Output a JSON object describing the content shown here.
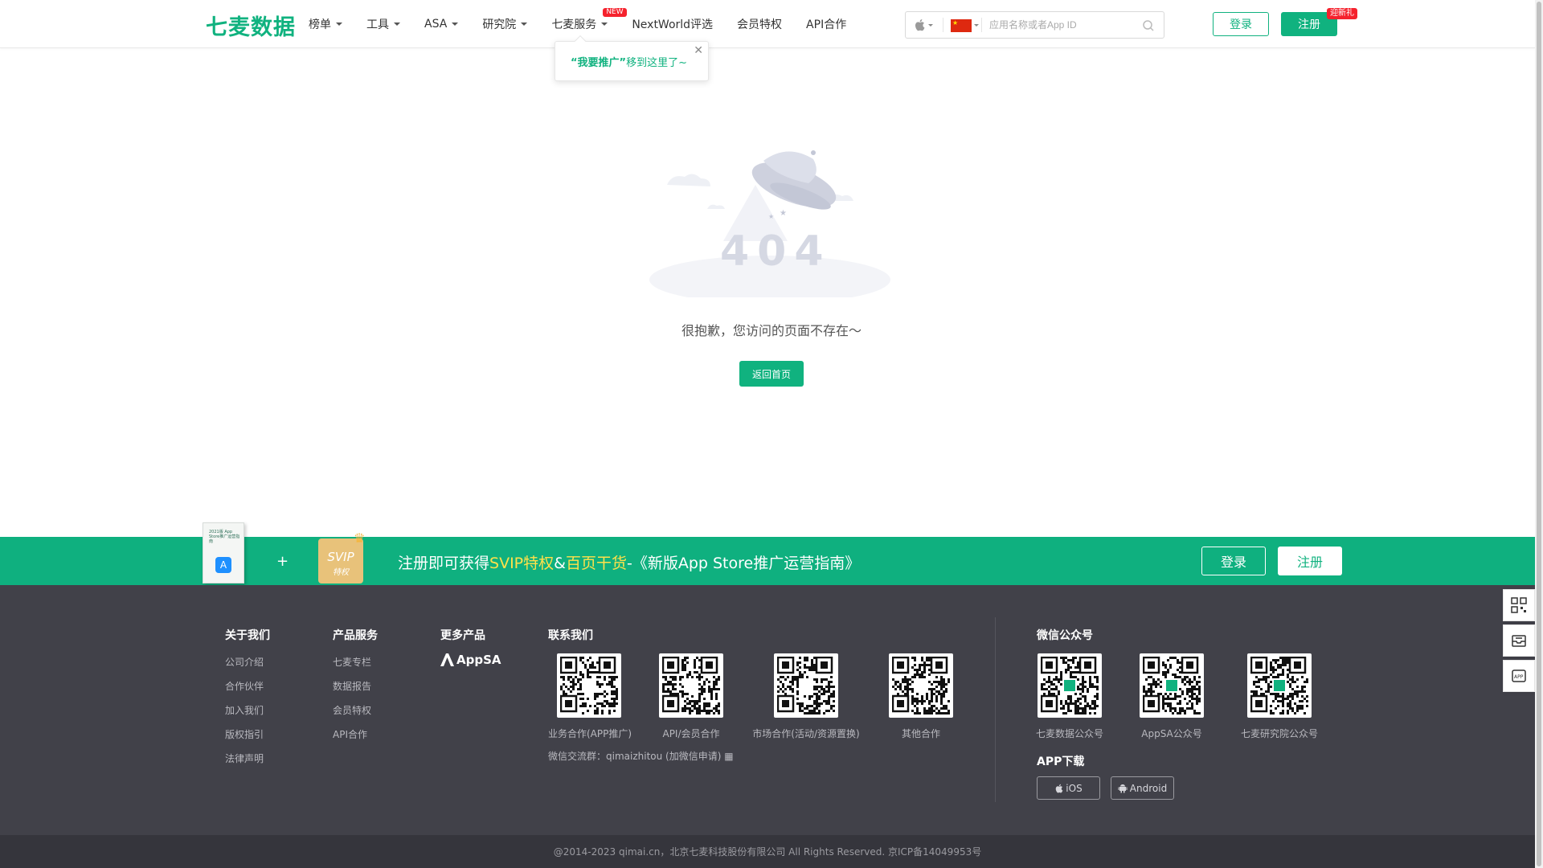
{
  "header": {
    "logo": "七麦数据",
    "nav": [
      {
        "label": "榜单"
      },
      {
        "label": "工具"
      },
      {
        "label": "ASA"
      },
      {
        "label": "研究院"
      },
      {
        "label": "七麦服务",
        "badge": "NEW"
      },
      {
        "label": "NextWorld评选"
      },
      {
        "label": "会员特权"
      },
      {
        "label": "API合作"
      }
    ],
    "search": {
      "platform": "apple-icon",
      "region": "china-flag",
      "placeholder": "应用名称或者App ID"
    },
    "login": "登录",
    "register": "注册",
    "register_badge": "迎新礼",
    "popover": {
      "strong": "“我要推广”",
      "text": " 移到这里了~"
    }
  },
  "main": {
    "code": "404",
    "message": "很抱歉，您访问的页面不存在～",
    "home_button": "返回首页"
  },
  "banner": {
    "book_title": "2021版 App Store推广运营指南",
    "plus": "+",
    "svip_a": "SVIP",
    "svip_b": "特权",
    "text_1": "注册即可获得",
    "text_svip": "SVIP特权",
    "text_amp": "&",
    "text_home": "百页干货",
    "text_2": "-《新版App Store推广运营指南》",
    "login": "登录",
    "register": "注册"
  },
  "footer": {
    "about": {
      "title": "关于我们",
      "links": [
        "公司介绍",
        "合作伙伴",
        "加入我们",
        "版权指引",
        "法律声明"
      ]
    },
    "products": {
      "title": "产品服务",
      "links": [
        "七麦专栏",
        "数据报告",
        "会员特权",
        "API合作"
      ]
    },
    "more": {
      "title": "更多产品",
      "appsa": "AppSA"
    },
    "contact": {
      "title": "联系我们",
      "qrs": [
        "业务合作(APP推广)",
        "API/会员合作",
        "市场合作(活动/资源置换)",
        "其他合作"
      ],
      "wechat_group": "微信交流群：qimaizhitou (加微信申请)"
    },
    "wechat": {
      "title": "微信公众号",
      "qrs": [
        "七麦数据公众号",
        "AppSA公众号",
        "七麦研究院公众号"
      ]
    },
    "app": {
      "title": "APP下载",
      "ios": "iOS",
      "android": "Android"
    },
    "copyright": "@2014-2023 qimai.cn，北京七麦科技股份有限公司 All Rights Reserved. 京ICP备14049953号"
  },
  "colors": {
    "brand": "#10b27f",
    "footer_bg": "#414149",
    "highlight": "#ffe14a"
  }
}
